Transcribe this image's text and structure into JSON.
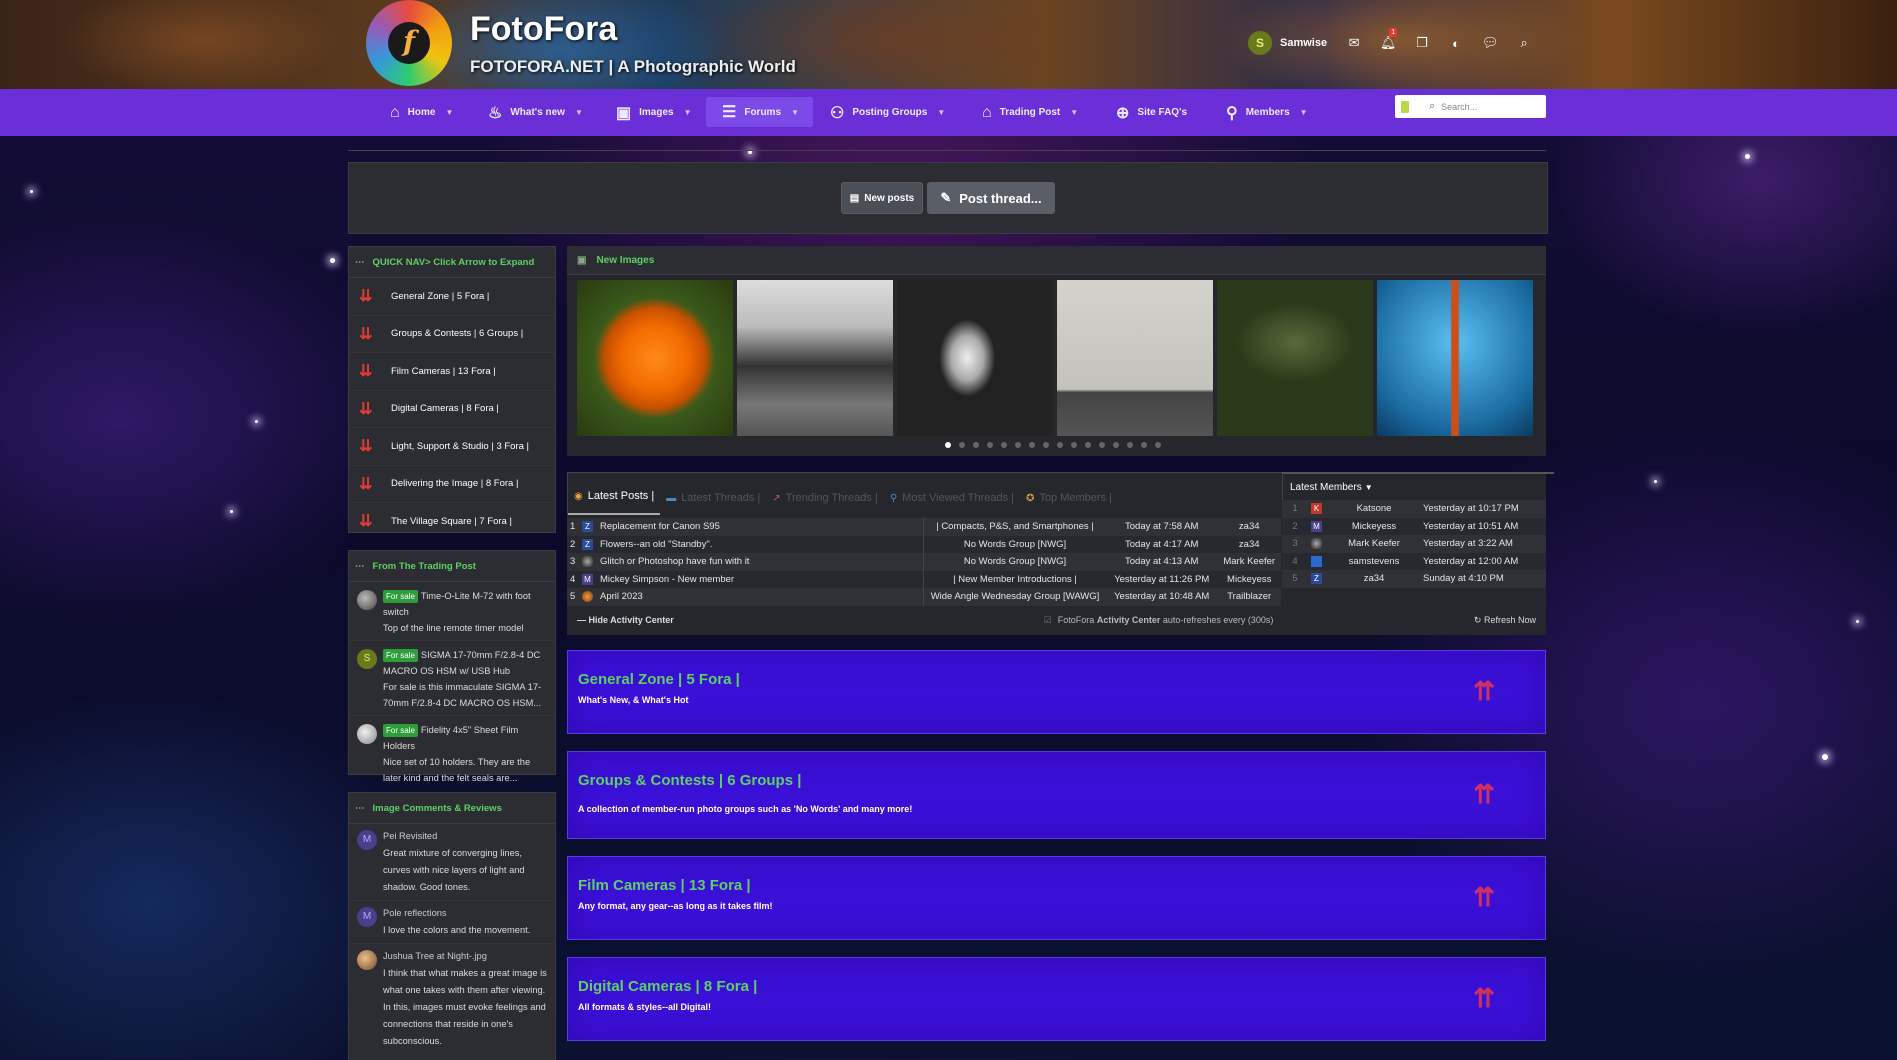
{
  "header": {
    "site_title": "FotoFora",
    "tagline": "FOTOFORA.NET | A Photographic World",
    "logo_letter": "f",
    "user": {
      "initial": "S",
      "name": "Samwise"
    },
    "alerts_badge": "1",
    "icons": [
      "envelope-icon",
      "bell-icon",
      "bookmarks-icon",
      "palette-icon",
      "chat-icon",
      "search-icon"
    ]
  },
  "nav": {
    "items": [
      {
        "label": "Home",
        "icon": "home-icon"
      },
      {
        "label": "What's new",
        "icon": "fire-icon"
      },
      {
        "label": "Images",
        "icon": "image-icon"
      },
      {
        "label": "Forums",
        "icon": "forums-icon",
        "active": true
      },
      {
        "label": "Posting Groups",
        "icon": "groups-icon"
      },
      {
        "label": "Trading Post",
        "icon": "store-icon"
      },
      {
        "label": "Site FAQ's",
        "icon": "globe-icon"
      },
      {
        "label": "Members",
        "icon": "user-icon"
      }
    ],
    "search_placeholder": "Search..."
  },
  "actions": {
    "new_posts": "New posts",
    "post_thread": "Post thread..."
  },
  "quick_nav": {
    "title": "QUICK NAV> Click Arrow to Expand",
    "items": [
      "General Zone | 5 Fora |",
      "Groups & Contests | 6 Groups |",
      "Film Cameras | 13 Fora |",
      "Digital Cameras | 8 Fora |",
      "Light, Support & Studio | 3 Fora |",
      "Delivering the Image | 8 Fora |",
      "The Village Square | 7 Fora |"
    ]
  },
  "trading_post": {
    "title": "From The Trading Post",
    "badge": "For sale",
    "items": [
      {
        "title": "Time-O-Lite M-72 with foot switch",
        "desc": "Top of the line remote timer model"
      },
      {
        "title": "SIGMA 17-70mm F/2.8-4 DC MACRO OS HSM w/ USB Hub",
        "desc": "For sale is this immaculate SIGMA 17-70mm F/2.8-4 DC MACRO OS HSM..."
      },
      {
        "title": "Fidelity 4x5\" Sheet Film Holders",
        "desc": "Nice set of 10 holders. They are the later kind and the felt seals are..."
      }
    ]
  },
  "image_comments": {
    "title": "Image Comments & Reviews",
    "items": [
      {
        "title": "Pei Revisited",
        "text": "Great mixture of converging lines, curves with nice layers of light and shadow. Good tones."
      },
      {
        "title": "Pole reflections",
        "text": "I love the colors and the movement."
      },
      {
        "title": "Jushua Tree at Night-.jpg",
        "text": "I think that what makes a great image is what one takes with them after viewing. In this, images must evoke feelings and connections that reside in one's subconscious."
      }
    ]
  },
  "new_images": {
    "title": "New Images",
    "count": 16,
    "active_index": 0
  },
  "activity": {
    "tabs": [
      {
        "label": "Latest Posts |",
        "icon": "posts-icon",
        "active": true
      },
      {
        "label": "Latest Threads |",
        "icon": "threads-icon"
      },
      {
        "label": "Trending Threads |",
        "icon": "trending-icon"
      },
      {
        "label": "Most Viewed Threads |",
        "icon": "views-icon"
      },
      {
        "label": "Top Members |",
        "icon": "medal-icon"
      }
    ],
    "posts": [
      {
        "n": "1",
        "av": "Z",
        "title": "Replacement for Canon S95",
        "forum": "| Compacts, P&S, and Smartphones |",
        "time": "Today at 7:58 AM",
        "user": "za34"
      },
      {
        "n": "2",
        "av": "Z",
        "title": "Flowers--an old \"Standby\".",
        "forum": "No Words Group [NWG]",
        "time": "Today at 4:17 AM",
        "user": "za34"
      },
      {
        "n": "3",
        "av": "",
        "title": "Glitch or Photoshop have fun with it",
        "forum": "No Words Group [NWG]",
        "time": "Today at 4:13 AM",
        "user": "Mark Keefer"
      },
      {
        "n": "4",
        "av": "M",
        "title": "Mickey Simpson - New member",
        "forum": "| New Member Introductions |",
        "time": "Yesterday at 11:26 PM",
        "user": "Mickeyess"
      },
      {
        "n": "5",
        "av": "",
        "title": "April 2023",
        "forum": "Wide Angle Wednesday Group [WAWG]",
        "time": "Yesterday at 10:48 AM",
        "user": "Trailblazer"
      }
    ],
    "members_title": "Latest Members",
    "members": [
      {
        "n": "1",
        "av": "K",
        "name": "Katsone",
        "time": "Yesterday at 10:17 PM"
      },
      {
        "n": "2",
        "av": "M",
        "name": "Mickeyess",
        "time": "Yesterday at 10:51 AM"
      },
      {
        "n": "3",
        "av": "",
        "name": "Mark Keefer",
        "time": "Yesterday at 3:22 AM"
      },
      {
        "n": "4",
        "av": "",
        "name": "samstevens",
        "time": "Yesterday at 12:00 AM"
      },
      {
        "n": "5",
        "av": "Z",
        "name": "za34",
        "time": "Sunday at 4:10 PM"
      }
    ],
    "hide_label": "Hide Activity Center",
    "autorefresh_pre": "FotoFora",
    "autorefresh_bold": "Activity Center",
    "autorefresh_post": "auto-refreshes every (300s)",
    "refresh_label": "Refresh Now"
  },
  "forums": [
    {
      "title": "General Zone | 5 Fora |",
      "desc": "What's New, & What's Hot"
    },
    {
      "title": "Groups & Contests | 6 Groups |",
      "desc": "A collection of member-run photo groups such as 'No Words' and many more!"
    },
    {
      "title": "Film Cameras | 13 Fora |",
      "desc": "Any format, any gear--as long as it takes film!"
    },
    {
      "title": "Digital Cameras | 8 Fora |",
      "desc": "All formats & styles--all Digital!"
    }
  ],
  "colors": {
    "nav": "#6a2fd6",
    "accent_green": "#5fd068",
    "forum_block": "#3a0fd6",
    "panel": "#2b2d33"
  }
}
